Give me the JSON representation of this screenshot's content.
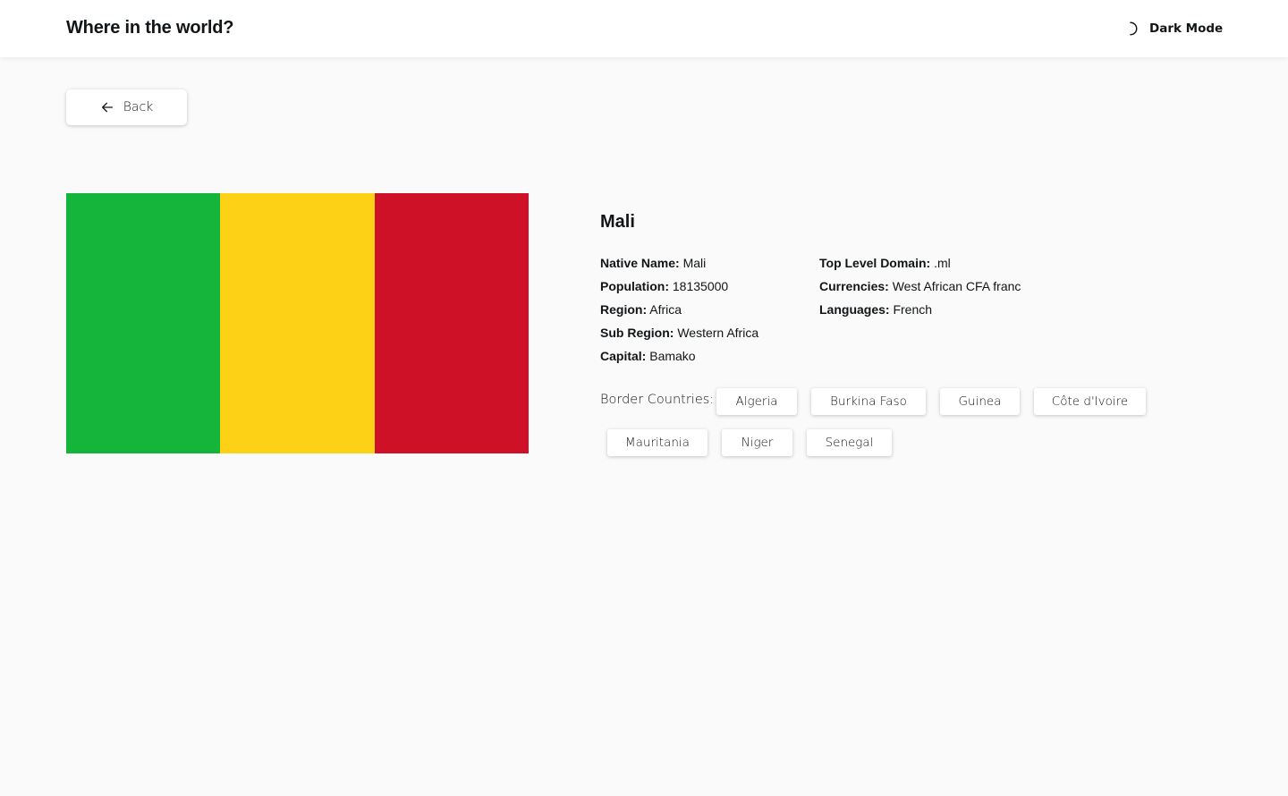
{
  "header": {
    "title": "Where in the world?",
    "dark_mode_label": "Dark Mode",
    "dark_mode_icon": "moon-icon"
  },
  "back": {
    "label": "Back",
    "icon": "arrow-left-icon"
  },
  "country": {
    "name": "Mali",
    "flag_colors": [
      "#14b53a",
      "#fcd116",
      "#ce1126"
    ],
    "details_left": [
      {
        "key": "Native Name:",
        "value": "Mali"
      },
      {
        "key": "Population:",
        "value": "18135000"
      },
      {
        "key": "Region:",
        "value": "Africa"
      },
      {
        "key": "Sub Region:",
        "value": "Western Africa"
      },
      {
        "key": "Capital:",
        "value": "Bamako"
      }
    ],
    "details_right": [
      {
        "key": "Top Level Domain:",
        "value": ".ml"
      },
      {
        "key": "Currencies:",
        "value": "West African CFA franc"
      },
      {
        "key": "Languages:",
        "value": "French"
      }
    ],
    "border_label": "Border Countries:",
    "borders": [
      "Algeria",
      "Burkina Faso",
      "Guinea",
      "Côte d'Ivoire",
      "Mauritania",
      "Niger",
      "Senegal"
    ]
  }
}
